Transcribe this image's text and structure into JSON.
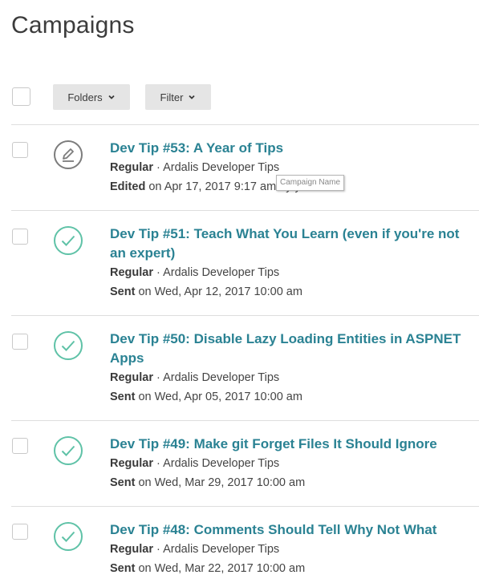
{
  "page": {
    "title": "Campaigns"
  },
  "toolbar": {
    "folders_label": "Folders",
    "filter_label": "Filter"
  },
  "tooltip": {
    "text": "Campaign Name"
  },
  "campaigns": [
    {
      "title": "Dev Tip #53: A Year of Tips",
      "type": "Regular",
      "sep": " · ",
      "list": "Ardalis Developer Tips",
      "status": "Edited",
      "date": " on Apr 17, 2017 9:17 am by you",
      "status_icon": "pencil-icon"
    },
    {
      "title": "Dev Tip #51: Teach What You Learn (even if you're not an expert)",
      "type": "Regular",
      "sep": " · ",
      "list": "Ardalis Developer Tips",
      "status": "Sent",
      "date": " on Wed, Apr 12, 2017 10:00 am",
      "status_icon": "check-icon"
    },
    {
      "title": "Dev Tip #50: Disable Lazy Loading Entities in ASPNET Apps",
      "type": "Regular",
      "sep": " · ",
      "list": "Ardalis Developer Tips",
      "status": "Sent",
      "date": " on Wed, Apr 05, 2017 10:00 am",
      "status_icon": "check-icon"
    },
    {
      "title": "Dev Tip #49: Make git Forget Files It Should Ignore",
      "type": "Regular",
      "sep": " · ",
      "list": "Ardalis Developer Tips",
      "status": "Sent",
      "date": " on Wed, Mar 29, 2017 10:00 am",
      "status_icon": "check-icon"
    },
    {
      "title": "Dev Tip #48: Comments Should Tell Why Not What",
      "type": "Regular",
      "sep": " · ",
      "list": "Ardalis Developer Tips",
      "status": "Sent",
      "date": " on Wed, Mar 22, 2017 10:00 am",
      "status_icon": "check-icon"
    }
  ],
  "colors": {
    "link": "#2a8293",
    "sent_icon": "#5fc2a7",
    "edit_icon": "#7c7c7c"
  }
}
